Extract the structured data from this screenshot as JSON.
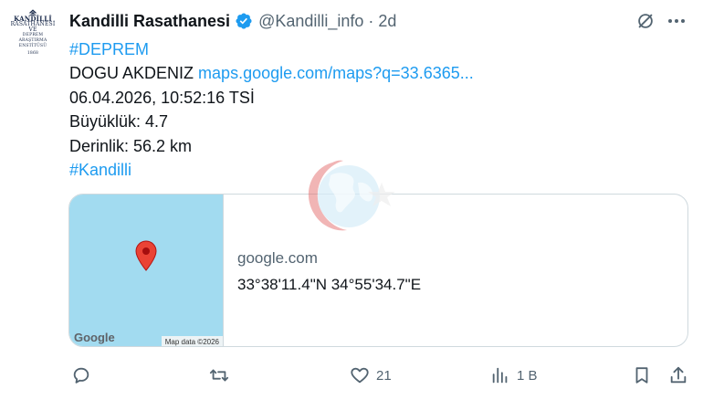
{
  "tweet": {
    "author_name": "Kandilli Rasathanesi",
    "author_handle": "@Kandilli_info",
    "separator": "·",
    "time": "2d",
    "hashtag_top": "#DEPREM",
    "location": "DOGU AKDENIZ",
    "maps_link": "maps.google.com/maps?q=33.6365...",
    "datetime": "06.04.2026, 10:52:16 TSİ",
    "magnitude": "Büyüklük: 4.7",
    "depth": "Derinlik: 56.2 km",
    "hashtag_bottom": "#Kandilli"
  },
  "avatar": {
    "lines": [
      "KANDİLLİ",
      "RASATHANESİ VE",
      "DEPREM ARAŞTIRMA",
      "ENSTİTÜSÜ",
      "1868"
    ]
  },
  "card": {
    "domain": "google.com",
    "title": "33°38'11.4\"N 34°55'34.7\"E",
    "map_logo": "Google",
    "map_data": "Map data ©2026"
  },
  "actions": {
    "replies": "",
    "reposts": "",
    "likes": "21",
    "views": "1 B"
  },
  "colors": {
    "accent": "#1d9bf0",
    "muted": "#536471",
    "map_water": "#a2dbf0",
    "pin": "#ea4335"
  },
  "icons": [
    "verified-icon",
    "grok-icon",
    "more-icon",
    "reply-icon",
    "repost-icon",
    "like-icon",
    "views-icon",
    "bookmark-icon",
    "share-icon",
    "map-pin-icon"
  ]
}
